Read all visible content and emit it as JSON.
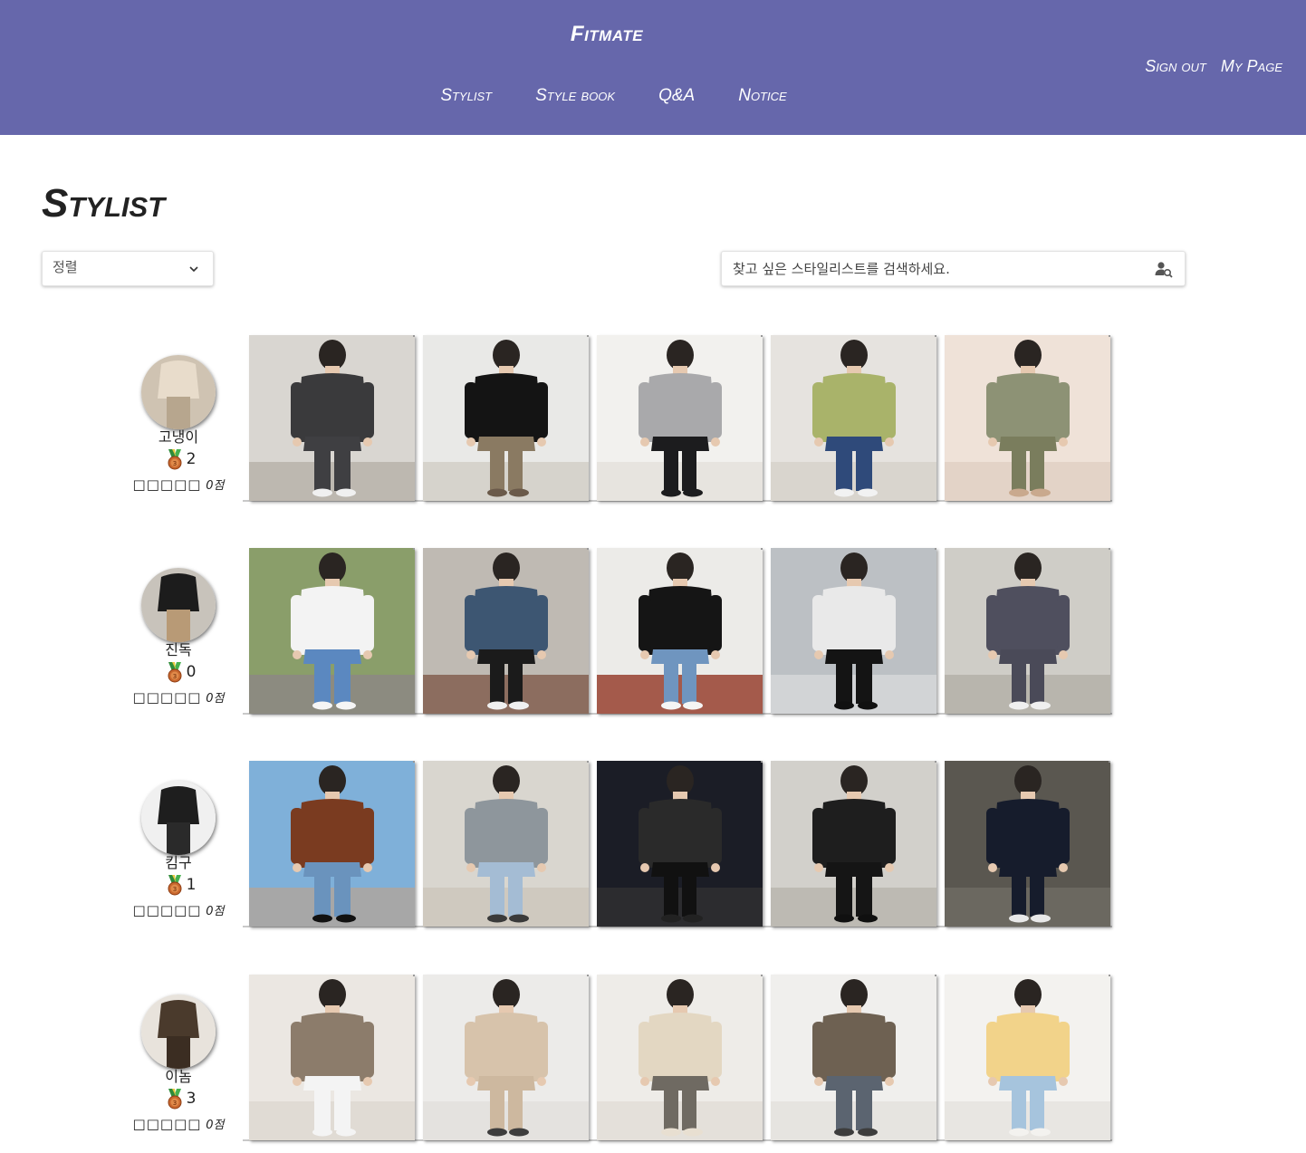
{
  "header": {
    "brand": "Fitmate",
    "nav": [
      "Stylist",
      "Style book",
      "Q&A",
      "Notice"
    ],
    "account": [
      "Sign out",
      "My Page"
    ],
    "background": "#6667ab"
  },
  "page": {
    "title": "Stylist",
    "sort_label": "정렬",
    "search_placeholder": "찾고 싶은 스타일리스트를 검색하세요."
  },
  "stylists": [
    {
      "name": "고냉이",
      "medal_icon": "bronze-medal-icon",
      "medal_count": "2",
      "stars": "□□□□□",
      "score": "0점",
      "avatar": {
        "bg": "#cfc3b2",
        "top": "#e8dccb",
        "bottom": "#b7a68e"
      },
      "photos": [
        {
          "bg": "#d9d6d1",
          "floor": "#bdb8b0",
          "top": "#3a3a3c",
          "bottom": "#3f3f42",
          "shoes": "#f0f0f0"
        },
        {
          "bg": "#e9e9e7",
          "floor": "#d6d3cc",
          "top": "#141414",
          "bottom": "#8a7a62",
          "shoes": "#6b5a4a"
        },
        {
          "bg": "#f2f1ee",
          "floor": "#e7e4df",
          "top": "#a9a9ab",
          "bottom": "#1c1c1e",
          "shoes": "#1c1c1e"
        },
        {
          "bg": "#e6e3df",
          "floor": "#d9d5ce",
          "top": "#a9b36a",
          "bottom": "#2f4a7a",
          "shoes": "#f2f2f2"
        },
        {
          "bg": "#efe2d8",
          "floor": "#e3d3c7",
          "top": "#8d9275",
          "bottom": "#7a7d5d",
          "shoes": "#c9a98e"
        }
      ]
    },
    {
      "name": "진독",
      "medal_icon": "bronze-medal-icon",
      "medal_count": "0",
      "stars": "□□□□□",
      "score": "0점",
      "avatar": {
        "bg": "#c8c3bb",
        "top": "#1c1c1c",
        "bottom": "#b89a76"
      },
      "photos": [
        {
          "bg": "#8a9e6a",
          "floor": "#8c8b80",
          "top": "#f3f3f3",
          "bottom": "#5b88c0",
          "shoes": "#f5f5f5"
        },
        {
          "bg": "#bfbab3",
          "floor": "#8c6d5f",
          "top": "#3d5672",
          "bottom": "#1b1b1b",
          "shoes": "#f0f0f0"
        },
        {
          "bg": "#ecebe8",
          "floor": "#a45a4b",
          "top": "#151515",
          "bottom": "#6f95bf",
          "shoes": "#f5f5f5"
        },
        {
          "bg": "#bcc0c4",
          "floor": "#d2d4d6",
          "top": "#e9e9e9",
          "bottom": "#141414",
          "shoes": "#111111"
        },
        {
          "bg": "#cfcdc7",
          "floor": "#b8b5ad",
          "top": "#4f4f5e",
          "bottom": "#4a4a58",
          "shoes": "#f0f0f0"
        }
      ]
    },
    {
      "name": "킴구",
      "medal_icon": "bronze-medal-icon",
      "medal_count": "1",
      "stars": "□□□□□",
      "score": "0점",
      "avatar": {
        "bg": "#f0f0f0",
        "top": "#1e1e1e",
        "bottom": "#2a2a2a"
      },
      "photos": [
        {
          "bg": "#7fb0d9",
          "floor": "#a7a7a7",
          "top": "#7a3b20",
          "bottom": "#6a93bd",
          "shoes": "#111111"
        },
        {
          "bg": "#d9d6cf",
          "floor": "#cfc9bf",
          "top": "#8e969c",
          "bottom": "#a4bcd4",
          "shoes": "#3a3a3a"
        },
        {
          "bg": "#1b1d26",
          "floor": "#2c2c2f",
          "top": "#2a2a2a",
          "bottom": "#111111",
          "shoes": "#222222"
        },
        {
          "bg": "#d2d0cb",
          "floor": "#bdbab3",
          "top": "#1e1e1e",
          "bottom": "#151515",
          "shoes": "#101010"
        },
        {
          "bg": "#5a5750",
          "floor": "#6b6860",
          "top": "#161c2c",
          "bottom": "#161c2c",
          "shoes": "#e8e8e8"
        }
      ]
    },
    {
      "name": "이놈",
      "medal_icon": "bronze-medal-icon",
      "medal_count": "3",
      "stars": "□□□□□",
      "score": "0점",
      "avatar": {
        "bg": "#e8e3dc",
        "top": "#4a3a2c",
        "bottom": "#3b2d22"
      },
      "photos": [
        {
          "bg": "#ebe7e2",
          "floor": "#e0dbd4",
          "top": "#8c7c6b",
          "bottom": "#f4f4f4",
          "shoes": "#f4f4f4"
        },
        {
          "bg": "#ecebe9",
          "floor": "#e4e2df",
          "top": "#d7c3ab",
          "bottom": "#cdb89f",
          "shoes": "#3d3d3d"
        },
        {
          "bg": "#eeece8",
          "floor": "#e4e0da",
          "top": "#e3d7c2",
          "bottom": "#6f6a62",
          "shoes": "#e8dfd1"
        },
        {
          "bg": "#f0efed",
          "floor": "#e6e4e0",
          "top": "#6e6152",
          "bottom": "#5b6470",
          "shoes": "#3d3d3d"
        },
        {
          "bg": "#f3f2ef",
          "floor": "#e8e6e2",
          "top": "#f2d38a",
          "bottom": "#a6c4dd",
          "shoes": "#f3f2ef"
        }
      ]
    }
  ]
}
